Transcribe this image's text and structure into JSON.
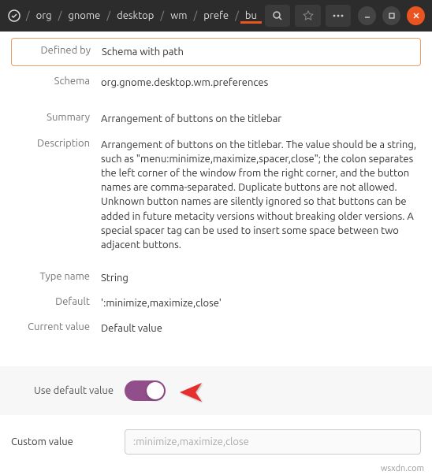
{
  "breadcrumb": [
    "org",
    "gnome",
    "desktop",
    "wm",
    "prefe",
    "bu"
  ],
  "rows": {
    "defined_by_label": "Defined by",
    "defined_by_value": "Schema with path",
    "schema_label": "Schema",
    "schema_value": "org.gnome.desktop.wm.preferences",
    "summary_label": "Summary",
    "summary_value": "Arrangement of buttons on the titlebar",
    "description_label": "Description",
    "description_value": "Arrangement of buttons on the titlebar. The value should be a string, such as \"menu:minimize,maximize,spacer,close\"; the colon separates the left corner of the window from the right corner, and the button names are comma-separated. Duplicate buttons are not allowed. Unknown button names are silently ignored so that buttons can be added in future metacity versions without breaking older versions. A special spacer tag can be used to insert some space between two adjacent buttons.",
    "typename_label": "Type name",
    "typename_value": "String",
    "default_label": "Default",
    "default_value": "':minimize,maximize,close'",
    "current_label": "Current value",
    "current_value": "Default value"
  },
  "controls": {
    "use_default_label": "Use default value",
    "custom_value_label": "Custom value",
    "custom_value_placeholder": ":minimize,maximize,close"
  },
  "footer": "wsxdn.com"
}
